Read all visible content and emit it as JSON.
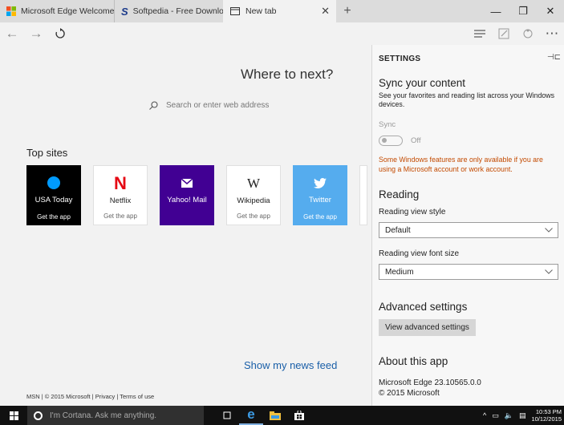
{
  "tabs": [
    {
      "label": "Microsoft Edge Welcome",
      "icon": "windows-logo-icon"
    },
    {
      "label": "Softpedia - Free Downloads",
      "icon": "softpedia-icon"
    },
    {
      "label": "New tab",
      "icon": "tab-icon",
      "active": true
    }
  ],
  "main": {
    "heading": "Where to next?",
    "search_placeholder": "Search or enter web address",
    "top_sites_label": "Top sites",
    "tiles": [
      {
        "name": "USA Today",
        "cta": "Get the app"
      },
      {
        "name": "Netflix",
        "cta": "Get the app"
      },
      {
        "name": "Yahoo! Mail",
        "cta": ""
      },
      {
        "name": "Wikipedia",
        "cta": "Get the app"
      },
      {
        "name": "Twitter",
        "cta": "Get the app"
      }
    ],
    "news_feed": "Show my news feed",
    "footer": "MSN | © 2015 Microsoft  | Privacy  | Terms of use"
  },
  "settings": {
    "title": "SETTINGS",
    "sync_heading": "Sync your content",
    "sync_desc": "See your favorites and reading list across your Windows devices.",
    "sync_label": "Sync",
    "sync_state": "Off",
    "sync_warning": "Some Windows features are only available if you are using a Microsoft account or work account.",
    "reading_heading": "Reading",
    "reading_style_label": "Reading view style",
    "reading_style_value": "Default",
    "reading_font_label": "Reading view font size",
    "reading_font_value": "Medium",
    "advanced_heading": "Advanced settings",
    "advanced_button": "View advanced settings",
    "about_heading": "About this app",
    "about_version": "Microsoft Edge 23.10565.0.0",
    "about_copyright": "© 2015 Microsoft"
  },
  "taskbar": {
    "cortana_placeholder": "I'm Cortana. Ask me anything.",
    "time": "10:53 PM",
    "date": "10/12/2015"
  },
  "colors": {
    "accent": "#1a5fa8",
    "warning": "#c34a00",
    "twitter": "#55acee",
    "yahoo": "#410093",
    "netflix": "#e50914"
  }
}
